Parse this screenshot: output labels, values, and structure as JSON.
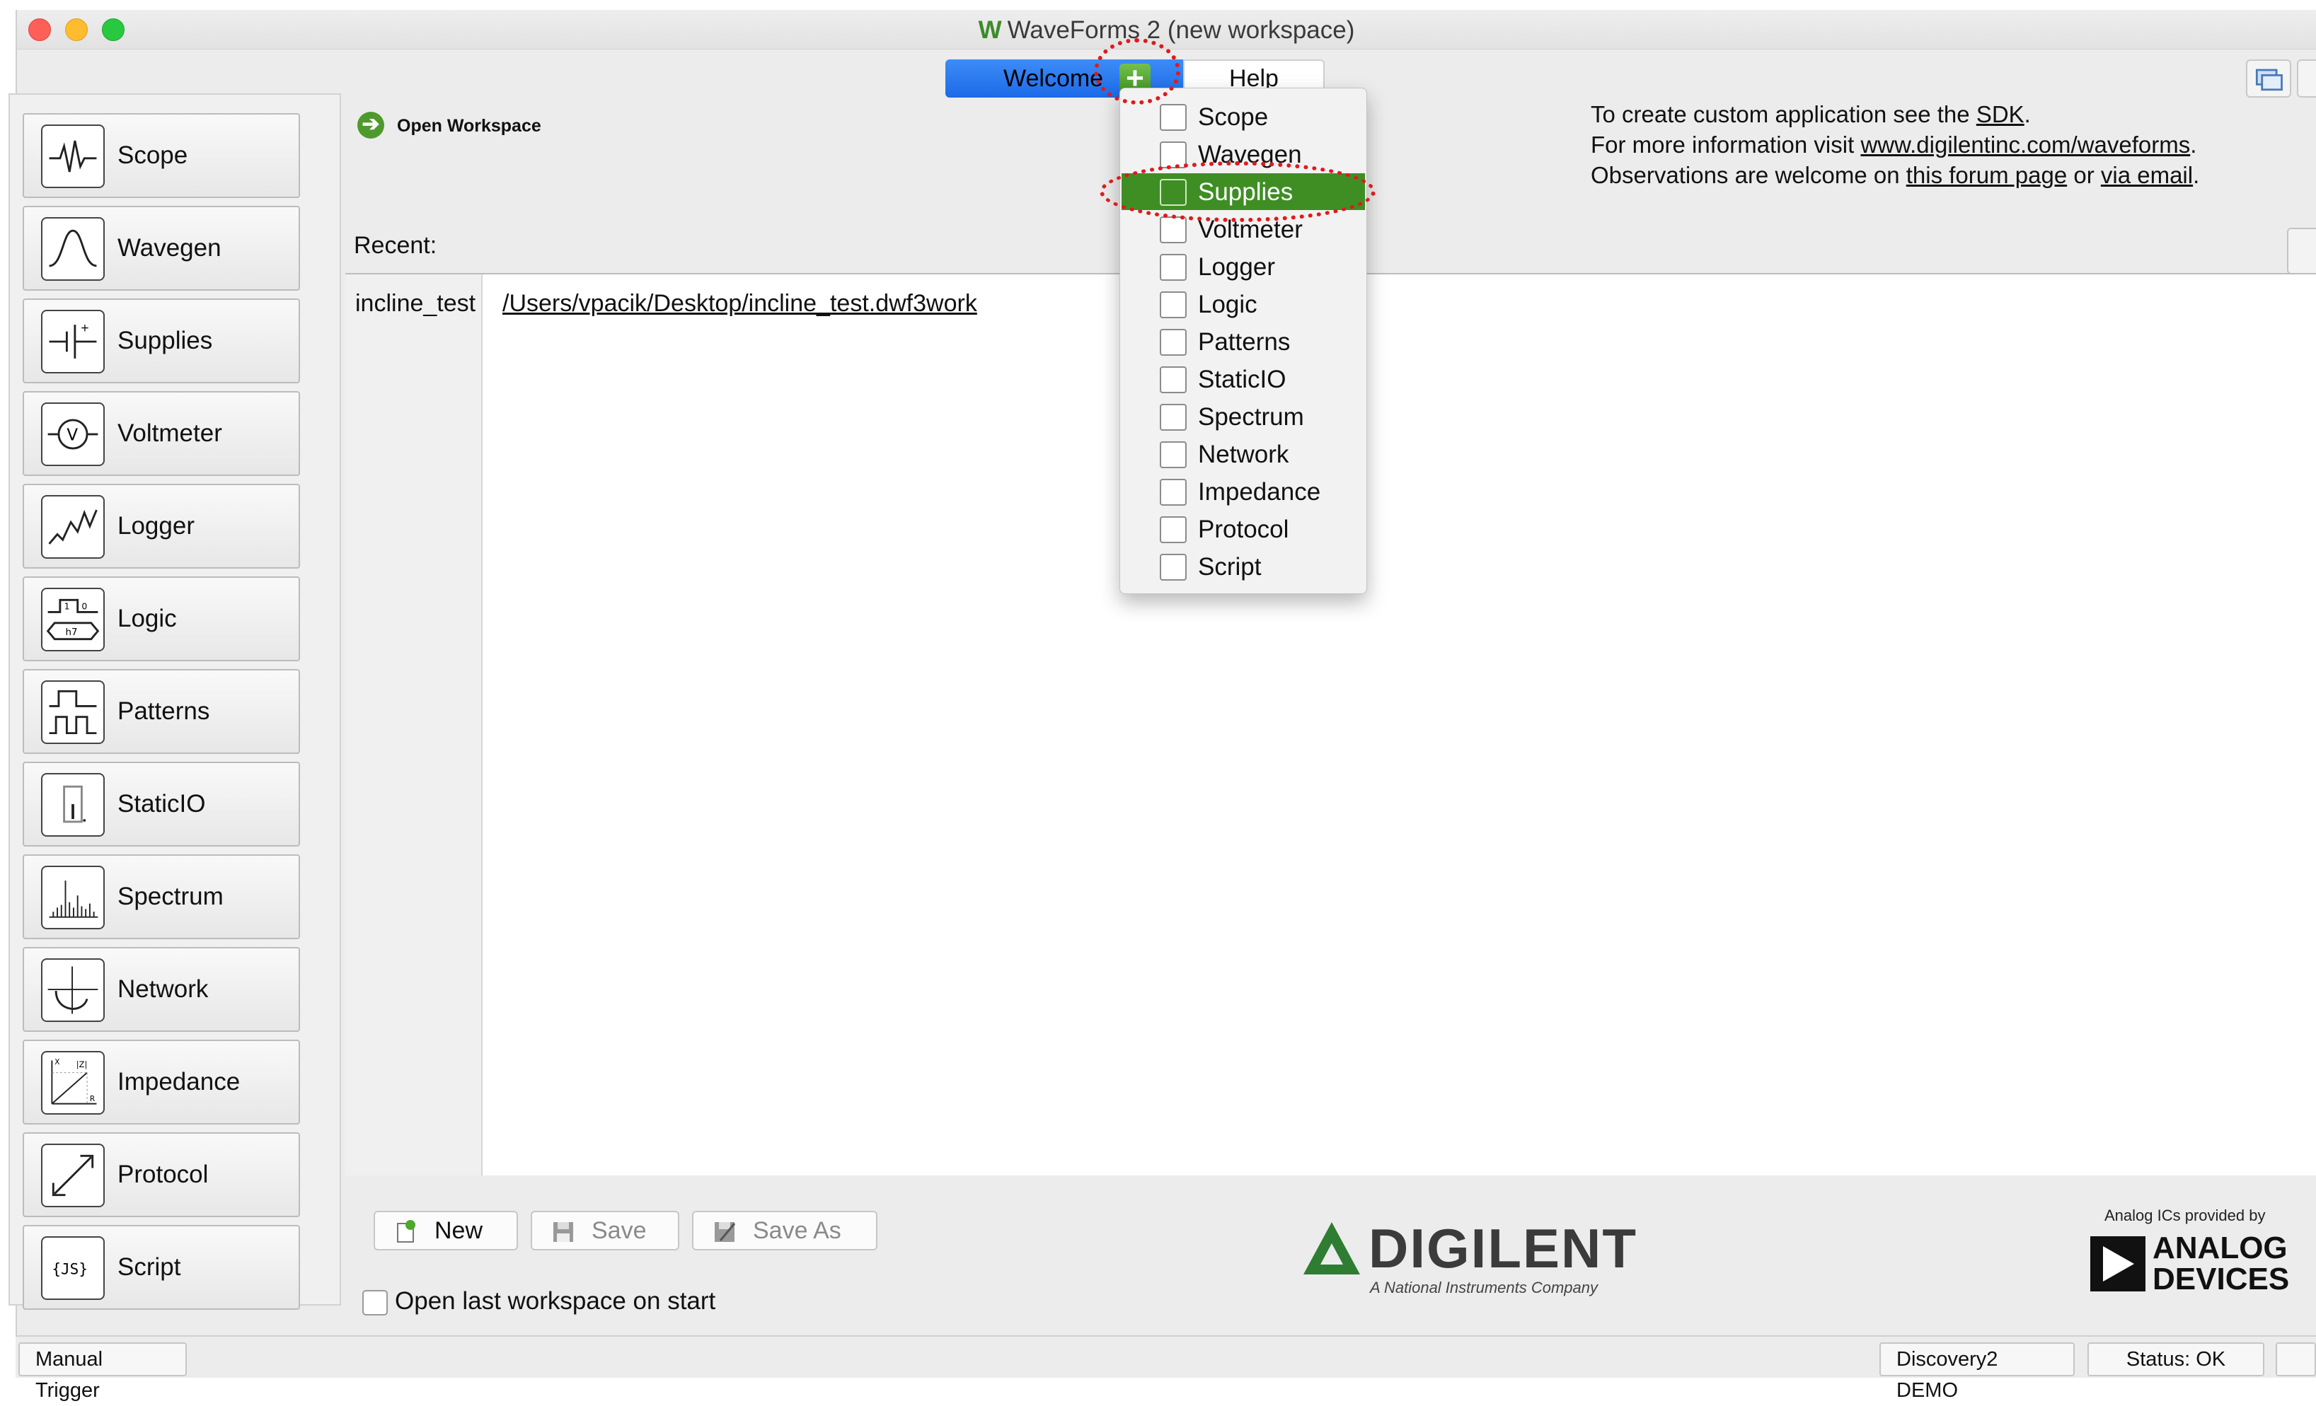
{
  "window": {
    "title": "WaveForms 2 (new workspace)",
    "logo_glyph": "W"
  },
  "tabs": {
    "welcome": "Welcome",
    "add": "+",
    "help": "Help"
  },
  "instruments": [
    {
      "label": "Scope",
      "icon": "scope-icon"
    },
    {
      "label": "Wavegen",
      "icon": "wavegen-icon"
    },
    {
      "label": "Supplies",
      "icon": "supplies-icon"
    },
    {
      "label": "Voltmeter",
      "icon": "voltmeter-icon"
    },
    {
      "label": "Logger",
      "icon": "logger-icon"
    },
    {
      "label": "Logic",
      "icon": "logic-icon"
    },
    {
      "label": "Patterns",
      "icon": "patterns-icon"
    },
    {
      "label": "StaticIO",
      "icon": "staticio-icon"
    },
    {
      "label": "Spectrum",
      "icon": "spectrum-icon"
    },
    {
      "label": "Network",
      "icon": "network-icon"
    },
    {
      "label": "Impedance",
      "icon": "impedance-icon"
    },
    {
      "label": "Protocol",
      "icon": "protocol-icon"
    },
    {
      "label": "Script",
      "icon": "script-icon"
    }
  ],
  "main": {
    "open_workspace": "Open Workspace",
    "recent_label": "Recent:",
    "recent_items": [
      {
        "name": "incline_test",
        "path": "/Users/vpacik/Desktop/incline_test.dwf3work"
      }
    ],
    "info": {
      "line1_prefix": "To create custom application see the ",
      "line1_link": "SDK",
      "line1_suffix": ".",
      "line2_prefix": "For more information visit ",
      "line2_link": "www.digilentinc.com/waveforms",
      "line2_suffix": ".",
      "line3_prefix": "Observations are welcome on ",
      "line3_link1": "this forum page",
      "line3_mid": " or ",
      "line3_link2": "via email",
      "line3_suffix": "."
    }
  },
  "bottom": {
    "new_label": "New",
    "save_label": "Save",
    "save_as_label": "Save As",
    "open_last_label": "Open last workspace on start",
    "open_last_checked": false,
    "digilent_name": "DIGILENT",
    "digilent_tagline": "A National Instruments Company",
    "ad_caption": "Analog ICs provided by",
    "ad_line1": "ANALOG",
    "ad_line2": "DEVICES"
  },
  "statusbar": {
    "trigger": "Manual Trigger",
    "device": "Discovery2 DEMO",
    "status": "Status: OK"
  },
  "add_menu": {
    "selected": "Supplies",
    "items": [
      "Scope",
      "Wavegen",
      "Supplies",
      "Voltmeter",
      "Logger",
      "Logic",
      "Patterns",
      "StaticIO",
      "Spectrum",
      "Network",
      "Impedance",
      "Protocol",
      "Script"
    ]
  },
  "colors": {
    "accent_green": "#3f8e24",
    "tab_blue": "#1c6ae8",
    "annotation_red": "#e01a1a"
  }
}
